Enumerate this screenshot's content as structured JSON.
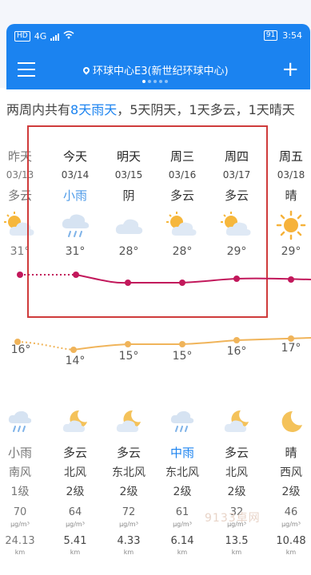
{
  "status": {
    "hd": "HD",
    "net": "4G",
    "battery": "91",
    "time": "3:54"
  },
  "nav": {
    "location": "环球中心E3(新世纪环球中心)"
  },
  "summary": {
    "prefix": "两周内共有",
    "rain": "8天雨天",
    "rest": "，5天阴天，1天多云，1天晴天"
  },
  "days": [
    {
      "name": "昨天",
      "date": "03/13",
      "cond": "多云",
      "icon": "partly-cloudy-sun-icon",
      "hi": "31°",
      "low": "16°"
    },
    {
      "name": "今天",
      "date": "03/14",
      "cond": "小雨",
      "icon": "cloud-rain-icon",
      "hi": "31°",
      "low": "14°"
    },
    {
      "name": "明天",
      "date": "03/15",
      "cond": "阴",
      "icon": "cloud-icon",
      "hi": "28°",
      "low": "15°"
    },
    {
      "name": "周三",
      "date": "03/16",
      "cond": "多云",
      "icon": "partly-cloudy-sun-icon",
      "hi": "28°",
      "low": "15°"
    },
    {
      "name": "周四",
      "date": "03/17",
      "cond": "多云",
      "icon": "partly-cloudy-sun-icon",
      "hi": "29°",
      "low": "16°"
    },
    {
      "name": "周五",
      "date": "03/18",
      "cond": "晴",
      "icon": "sun-icon",
      "hi": "29°",
      "low": "17°"
    }
  ],
  "nights": [
    {
      "cond": "小雨",
      "icon": "night-rain-icon",
      "wind": "南风",
      "level": "1级",
      "aqi": "70",
      "aqi_unit": "μg/m³",
      "vis": "24.13",
      "vis_unit": "km"
    },
    {
      "cond": "多云",
      "icon": "night-cloudy-moon-icon",
      "wind": "北风",
      "level": "2级",
      "aqi": "64",
      "aqi_unit": "μg/m³",
      "vis": "5.41",
      "vis_unit": "km"
    },
    {
      "cond": "多云",
      "icon": "night-cloudy-moon-icon",
      "wind": "东北风",
      "level": "2级",
      "aqi": "72",
      "aqi_unit": "μg/m³",
      "vis": "4.33",
      "vis_unit": "km"
    },
    {
      "cond": "中雨",
      "icon": "night-rain-icon",
      "wind": "东北风",
      "level": "2级",
      "aqi": "61",
      "aqi_unit": "μg/m³",
      "vis": "6.14",
      "vis_unit": "km"
    },
    {
      "cond": "多云",
      "icon": "night-cloudy-moon-icon",
      "wind": "北风",
      "level": "2级",
      "aqi": "32",
      "aqi_unit": "μg/m³",
      "vis": "13.5",
      "vis_unit": "km"
    },
    {
      "cond": "晴",
      "icon": "moon-icon",
      "wind": "西风",
      "level": "2级",
      "aqi": "46",
      "aqi_unit": "μg/m³",
      "vis": "10.48",
      "vis_unit": "km"
    }
  ],
  "watermark": "9133卓网",
  "colors": {
    "brand": "#1b83f0",
    "high_line": "#c2185b",
    "low_line": "#f0b45a",
    "box": "#cf3b3b"
  }
}
